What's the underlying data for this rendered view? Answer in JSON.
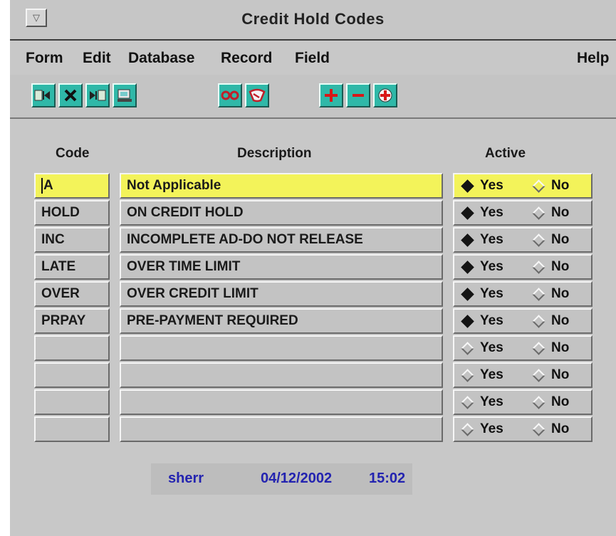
{
  "window": {
    "title": "Credit Hold Codes",
    "system_menu_glyph": "▽"
  },
  "menu": {
    "form": "Form",
    "edit": "Edit",
    "database": "Database",
    "record": "Record",
    "field": "Field",
    "help": "Help"
  },
  "toolbar": {
    "icons": [
      "first-record-icon",
      "delete-icon",
      "last-record-icon",
      "print-icon",
      "view-icon",
      "query-icon",
      "add-record-icon",
      "remove-record-icon",
      "medical-insert-icon"
    ]
  },
  "columns": {
    "code": "Code",
    "description": "Description",
    "active": "Active"
  },
  "rows": [
    {
      "code": "A",
      "description": "Not Applicable",
      "active": "Yes",
      "current": true
    },
    {
      "code": "HOLD",
      "description": "ON CREDIT HOLD",
      "active": "Yes",
      "current": false
    },
    {
      "code": "INC",
      "description": "INCOMPLETE AD-DO NOT RELEASE",
      "active": "Yes",
      "current": false
    },
    {
      "code": "LATE",
      "description": "OVER TIME LIMIT",
      "active": "Yes",
      "current": false
    },
    {
      "code": "OVER",
      "description": "OVER CREDIT LIMIT",
      "active": "Yes",
      "current": false
    },
    {
      "code": "PRPAY",
      "description": "PRE-PAYMENT REQUIRED",
      "active": "Yes",
      "current": false
    },
    {
      "code": "",
      "description": "",
      "active": "",
      "current": false
    },
    {
      "code": "",
      "description": "",
      "active": "",
      "current": false
    },
    {
      "code": "",
      "description": "",
      "active": "",
      "current": false
    },
    {
      "code": "",
      "description": "",
      "active": "",
      "current": false
    }
  ],
  "radio_labels": {
    "yes": "Yes",
    "no": "No"
  },
  "status": {
    "user": "sherr",
    "date": "04/12/2002",
    "time": "15:02"
  },
  "colors": {
    "current_row": "#f3f35a",
    "status_text": "#2323b0",
    "toolbar_button": "#2fb8a8"
  }
}
